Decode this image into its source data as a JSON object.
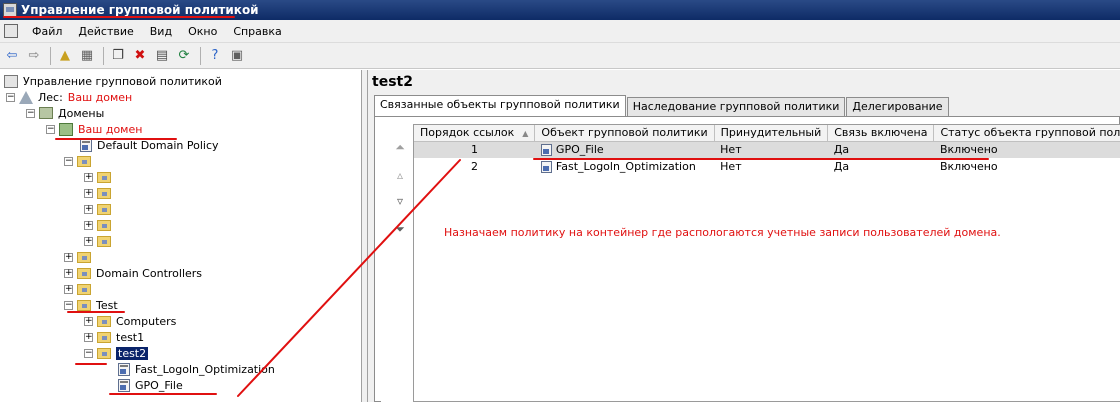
{
  "window": {
    "title": "Управление групповой политикой"
  },
  "menu": [
    "Файл",
    "Действие",
    "Вид",
    "Окно",
    "Справка"
  ],
  "toolbar": [
    {
      "name": "back-icon",
      "glyph": "⇦",
      "color": "#2c64c8"
    },
    {
      "name": "forward-icon",
      "glyph": "⇨",
      "color": "#808080"
    },
    {
      "sep": true
    },
    {
      "name": "up-folder-icon",
      "glyph": "▲",
      "color": "#c8a020"
    },
    {
      "name": "show-hide-tree-icon",
      "glyph": "▦",
      "color": "#606060"
    },
    {
      "sep": true
    },
    {
      "name": "copy-icon",
      "glyph": "❐",
      "color": "#404040"
    },
    {
      "name": "delete-icon",
      "glyph": "✖",
      "color": "#d01010"
    },
    {
      "name": "properties-icon",
      "glyph": "▤",
      "color": "#505050"
    },
    {
      "name": "refresh-icon",
      "glyph": "⟳",
      "color": "#208040"
    },
    {
      "sep": true
    },
    {
      "name": "help-icon",
      "glyph": "?",
      "color": "#2c64c8"
    },
    {
      "name": "action-pane-icon",
      "glyph": "▣",
      "color": "#606060"
    }
  ],
  "tree": {
    "root": "Управление групповой политикой",
    "forest_label": "Лес:",
    "forest_name": "Ваш домен",
    "domains": "Домены",
    "domain_name": "Ваш домен",
    "default_policy": "Default Domain Policy",
    "domain_controllers": "Domain Controllers",
    "test": "Test",
    "computers": "Computers",
    "test1": "test1",
    "test2": "test2",
    "fast_logon": "Fast_Logoln_Optimization",
    "gpo_file": "GPO_File"
  },
  "right": {
    "title": "test2",
    "tabs": [
      "Связанные объекты групповой политики",
      "Наследование групповой политики",
      "Делегирование"
    ],
    "columns": [
      "Порядок ссылок",
      "Объект групповой политики",
      "Принудительный",
      "Связь включена",
      "Статус объекта групповой политики"
    ],
    "rows": [
      {
        "order": "1",
        "gpo": "GPO_File",
        "enforced": "Нет",
        "link_enabled": "Да",
        "status": "Включено",
        "selected": true
      },
      {
        "order": "2",
        "gpo": "Fast_Logoln_Optimization",
        "enforced": "Нет",
        "link_enabled": "Да",
        "status": "Включено",
        "selected": false
      }
    ],
    "annotation": "Назначаем политику на контейнер где распологаются учетные записи пользователей домена."
  },
  "colors": {
    "annotation_red": "#e01010",
    "selection": "#0a246a",
    "title_bar": "#0e2b66"
  }
}
